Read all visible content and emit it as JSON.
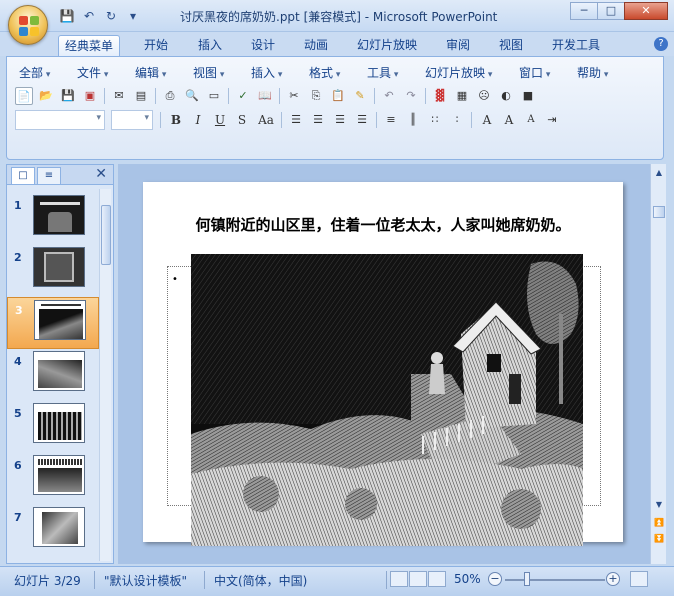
{
  "window": {
    "title": "讨厌黑夜的席奶奶.ppt [兼容模式] - Microsoft PowerPoint",
    "controls": [
      "minimize",
      "maximize",
      "close"
    ]
  },
  "quick_access": {
    "icons": [
      "save-icon",
      "undo-icon",
      "redo-icon",
      "customize-icon"
    ]
  },
  "ribbon_tabs": [
    {
      "label": "经典菜单",
      "active": true
    },
    {
      "label": "开始"
    },
    {
      "label": "插入"
    },
    {
      "label": "设计"
    },
    {
      "label": "动画"
    },
    {
      "label": "幻灯片放映"
    },
    {
      "label": "审阅"
    },
    {
      "label": "视图"
    },
    {
      "label": "开发工具"
    }
  ],
  "menus": [
    "全部",
    "文件",
    "编辑",
    "视图",
    "插入",
    "格式",
    "工具",
    "幻灯片放映",
    "窗口",
    "帮助"
  ],
  "format_buttons": {
    "bold": "B",
    "italic": "I",
    "underline": "U",
    "strike": "S",
    "case": "Aa",
    "font_grow": "A",
    "font_shrink": "A"
  },
  "slides_panel": {
    "slides": [
      {
        "number": "1"
      },
      {
        "number": "2"
      },
      {
        "number": "3",
        "selected": true
      },
      {
        "number": "4"
      },
      {
        "number": "5"
      },
      {
        "number": "6"
      },
      {
        "number": "7"
      }
    ]
  },
  "slide": {
    "title": "何镇附近的山区里，住着一位老太太，人家叫她席奶奶。",
    "bullet": "•"
  },
  "status": {
    "slide_pos": "幻灯片 3/29",
    "template": "\"默认设计模板\"",
    "language": "中文(简体，中国)",
    "zoom": "50%"
  },
  "colors": {
    "accent": "#15428b",
    "selected": "#f3a84f"
  }
}
